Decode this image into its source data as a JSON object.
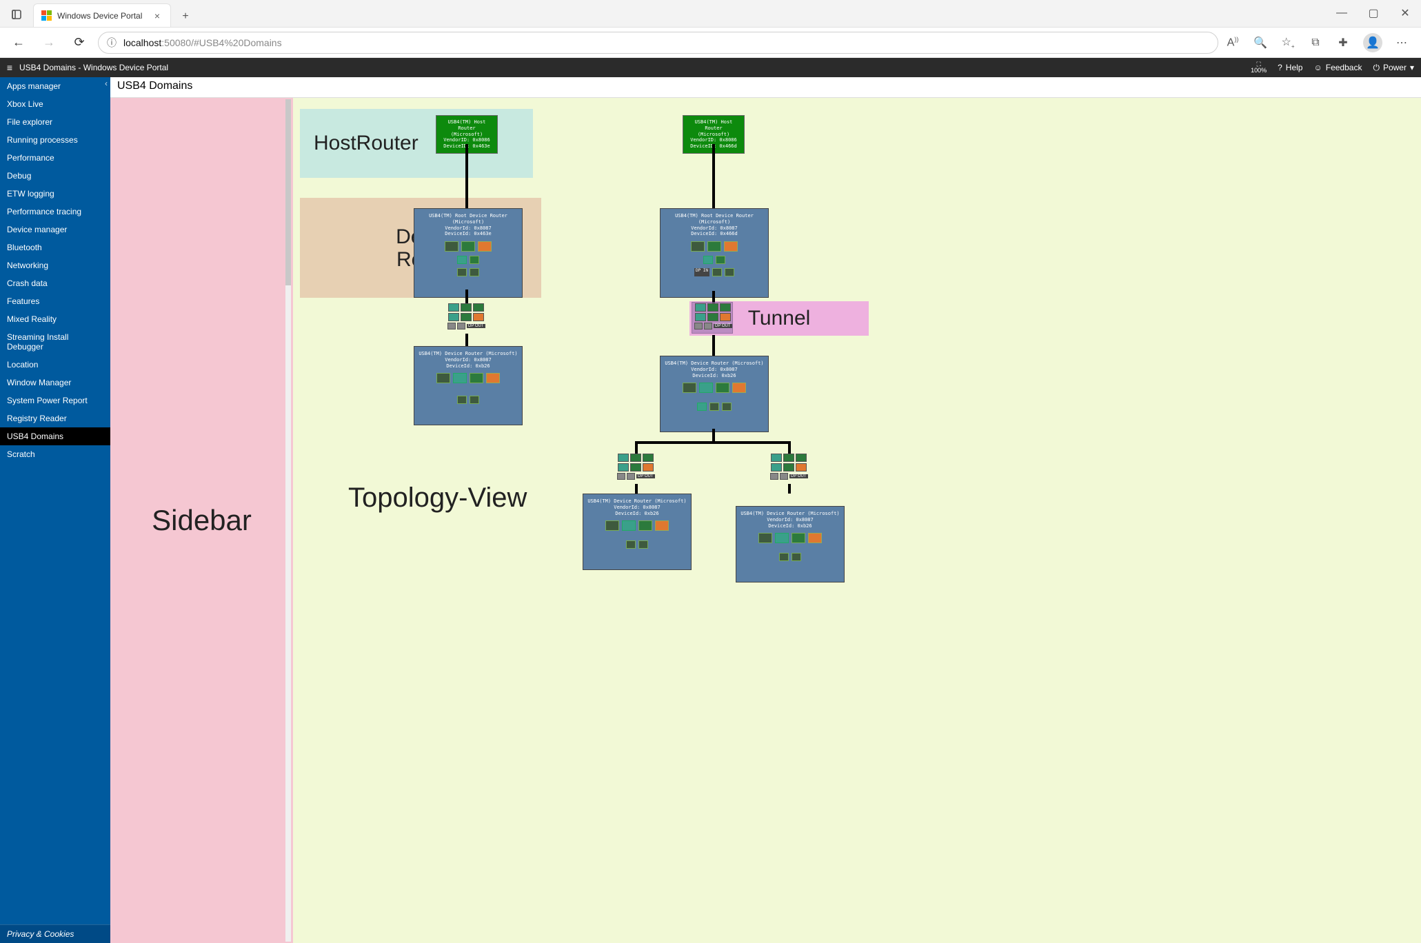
{
  "window": {
    "tab_title": "Windows Device Portal",
    "url_prefix": "localhost",
    "url_suffix": ":50080/#USB4%20Domains",
    "zoom": "100%",
    "win_min": "—",
    "win_max": "▢",
    "win_close": "✕"
  },
  "toolbar": {
    "help": "Help",
    "feedback": "Feedback",
    "power": "Power",
    "breadcrumb": "USB4 Domains - Windows Device Portal"
  },
  "page": {
    "title": "USB4 Domains"
  },
  "sidebar": {
    "footer": "Privacy & Cookies",
    "items": [
      "Apps manager",
      "Xbox Live",
      "File explorer",
      "Running processes",
      "Performance",
      "Debug",
      "ETW logging",
      "Performance tracing",
      "Device manager",
      "Bluetooth",
      "Networking",
      "Crash data",
      "Features",
      "Mixed Reality",
      "Streaming Install Debugger",
      "Location",
      "Window Manager",
      "System Power Report",
      "Registry Reader",
      "USB4 Domains",
      "Scratch"
    ],
    "active_index": 19
  },
  "annotations": {
    "sidebar": "Sidebar",
    "hostrouter": "HostRouter",
    "devicerouter": "Device Router",
    "tunnel": "Tunnel",
    "topologyview": "Topology-View"
  },
  "topology": {
    "left": {
      "host": {
        "lines": [
          "USB4(TM) Host Router",
          "(Microsoft)",
          "VendorID: 0x8086",
          "DeviceID: 0x463e"
        ]
      },
      "root": {
        "lines": [
          "USB4(TM) Root Device Router (Microsoft)",
          "VendorId: 0x8087",
          "DeviceId: 0x463e"
        ]
      },
      "dev1": {
        "lines": [
          "USB4(TM) Device Router (Microsoft)",
          "VendorId: 0x8087",
          "DeviceId: 0xb26"
        ]
      },
      "dp_out": "DP OUT"
    },
    "right": {
      "host": {
        "lines": [
          "USB4(TM) Host Router",
          "(Microsoft)",
          "VendorID: 0x8086",
          "DeviceID: 0x466d"
        ]
      },
      "root": {
        "lines": [
          "USB4(TM) Root Device Router (Microsoft)",
          "VendorId: 0x8087",
          "DeviceId: 0x466d"
        ]
      },
      "dev1": {
        "lines": [
          "USB4(TM) Device Router (Microsoft)",
          "VendorId: 0x8087",
          "DeviceId: 0xb26"
        ]
      },
      "dev2": {
        "lines": [
          "USB4(TM) Device Router (Microsoft)",
          "VendorId: 0x8087",
          "DeviceId: 0xb26"
        ]
      },
      "dev3": {
        "lines": [
          "USB4(TM) Device Router (Microsoft)",
          "VendorId: 0x8087",
          "DeviceId: 0xb26"
        ]
      },
      "dp_in": "DP IN",
      "dp_out": "DP OUT"
    }
  }
}
